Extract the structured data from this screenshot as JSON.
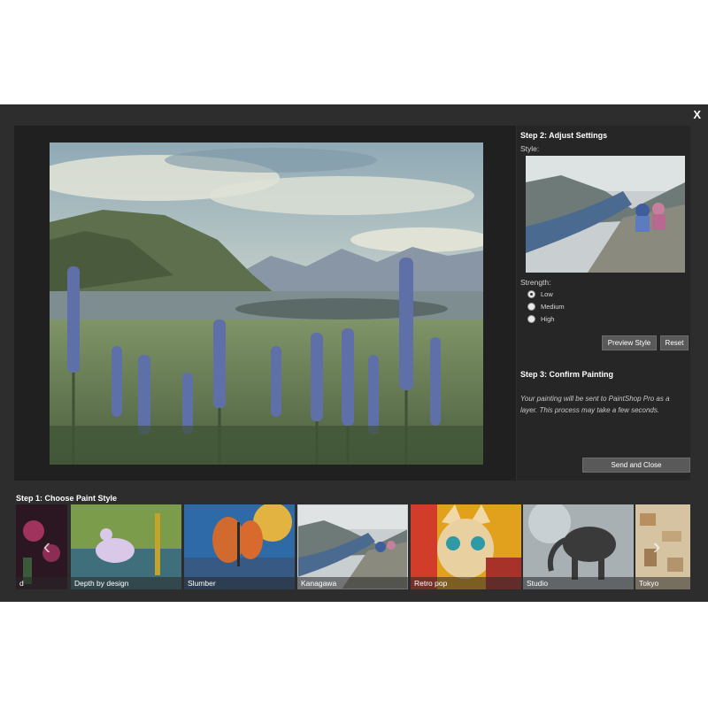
{
  "dialog": {
    "close_label": "X"
  },
  "settings": {
    "step2_title": "Step 2: Adjust Settings",
    "style_label": "Style:",
    "strength_label": "Strength:",
    "strength_options": [
      {
        "label": "Low",
        "checked": true
      },
      {
        "label": "Medium",
        "checked": false
      },
      {
        "label": "High",
        "checked": false
      }
    ],
    "preview_button": "Preview Style",
    "reset_button": "Reset",
    "step3_title": "Step 3: Confirm Painting",
    "confirm_text": "Your painting will be sent to PaintShop Pro as a layer. This process may take a few seconds.",
    "send_button": "Send and Close"
  },
  "strip": {
    "step1_title": "Step 1: Choose Paint Style",
    "styles": [
      {
        "label": "d"
      },
      {
        "label": "Depth by design"
      },
      {
        "label": "Slumber"
      },
      {
        "label": "Kanagawa"
      },
      {
        "label": "Retro pop"
      },
      {
        "label": "Studio"
      },
      {
        "label": "Tokyo"
      }
    ],
    "prev_arrow": "‹",
    "next_arrow": "›"
  }
}
